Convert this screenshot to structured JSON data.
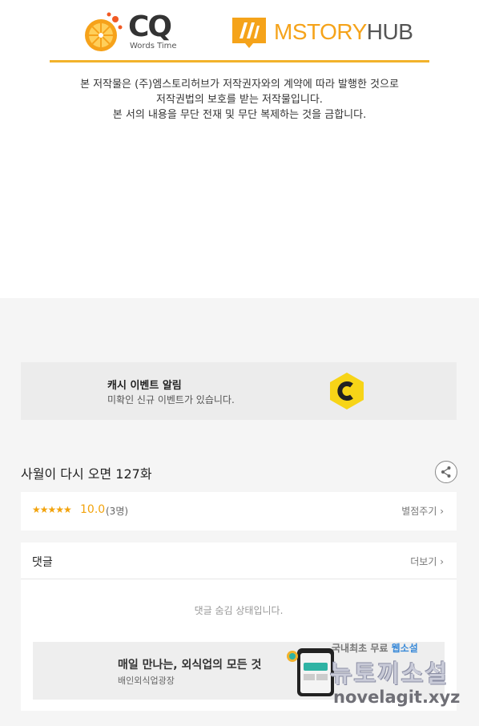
{
  "header": {
    "cq_logo_text": "CQ",
    "cq_logo_sub": "Words Time",
    "ms_logo_text_ms": "MSTORY",
    "ms_logo_text_hub": "HUB",
    "copyright_lines": [
      "본 저작물은 (주)엠스토리허브가 저작권자와의 계약에 따라 발행한 것으로",
      "저작권법의 보호를 받는 저작물입니다.",
      "본 서의 내용을 무단 전재 및 무단 복제하는 것을 금합니다."
    ]
  },
  "event_banner": {
    "title": "캐시 이벤트 알림",
    "subtitle": "미확인 신규 이벤트가 있습니다."
  },
  "episode": {
    "title": "사월이 다시 오면 127화"
  },
  "rating": {
    "stars": "★★★★★",
    "score": "10.0",
    "count": "(3명)",
    "rate_link": "별점주기 ›"
  },
  "comments": {
    "label": "댓글",
    "more": "더보기 ›",
    "hidden_message": "댓글 숨김 상태입니다."
  },
  "ad": {
    "title": "매일 만나는, 외식업의 모든 것",
    "subtitle": "배인외식업광장"
  },
  "watermark": {
    "line1_prefix": "국내최초 무료 ",
    "line1_highlight": "웹소설",
    "line2": "뉴토끼소설",
    "line3": "novelagit.xyz"
  },
  "colors": {
    "accent_orange": "#f5a31a",
    "divider": "#f2b22b",
    "star": "#f2a30c",
    "cash_icon": "#f7d417"
  }
}
